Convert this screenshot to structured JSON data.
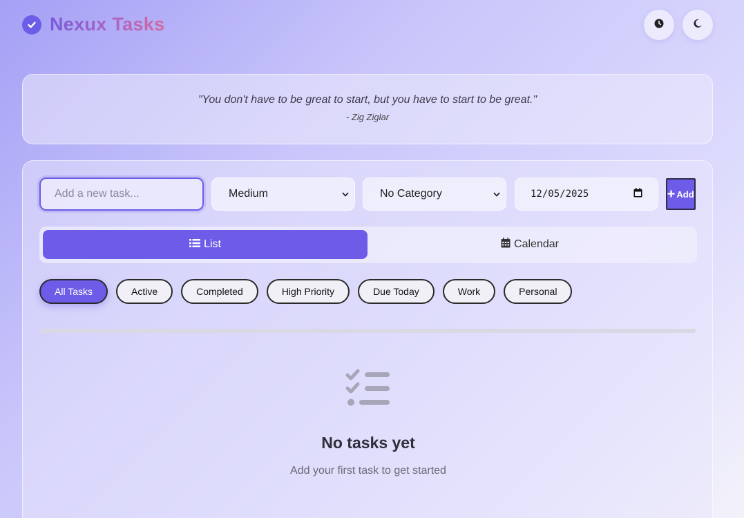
{
  "header": {
    "title": "Nexux Tasks",
    "logo_icon": "check-circle-icon",
    "history_icon": "clock-icon",
    "theme_icon": "moon-icon"
  },
  "quote": {
    "text": "\"You don't have to be great to start, but you have to start to be great.\"",
    "author": "- Zig Ziglar"
  },
  "form": {
    "task_placeholder": "Add a new task...",
    "task_value": "",
    "priority_selected": "Medium",
    "category_selected": "No Category",
    "due_date": "12/05/2025",
    "add_label": "Add"
  },
  "views": {
    "list_label": "List",
    "calendar_label": "Calendar",
    "active": "List"
  },
  "filters": [
    {
      "label": "All Tasks",
      "active": true
    },
    {
      "label": "Active",
      "active": false
    },
    {
      "label": "Completed",
      "active": false
    },
    {
      "label": "High Priority",
      "active": false
    },
    {
      "label": "Due Today",
      "active": false
    },
    {
      "label": "Work",
      "active": false
    },
    {
      "label": "Personal",
      "active": false
    }
  ],
  "progress": {
    "fraction": 0
  },
  "empty_state": {
    "icon": "tasks-list-icon",
    "title": "No tasks yet",
    "subtitle": "Add your first task to get started"
  },
  "colors": {
    "accent": "#6c5ce7",
    "chip_bg": "#f1f0f7"
  }
}
